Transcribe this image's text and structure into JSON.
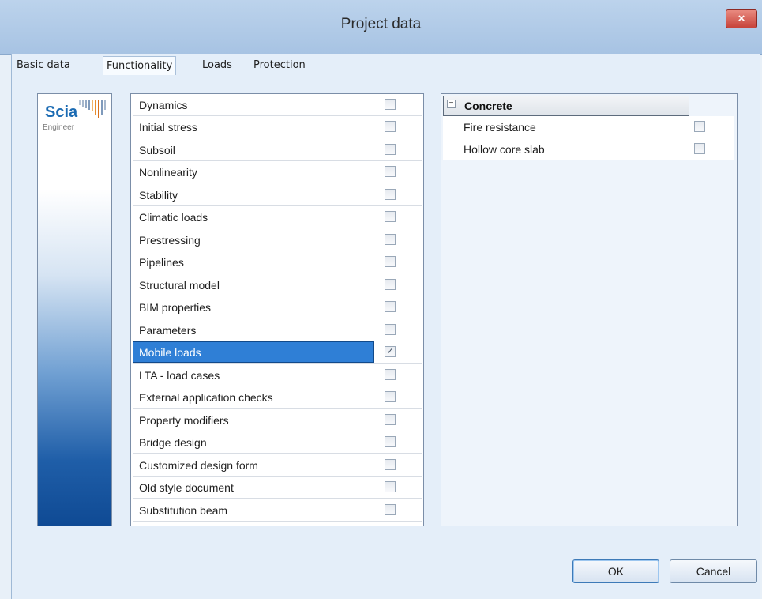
{
  "window": {
    "title": "Project data",
    "close_label": "×"
  },
  "tabs": [
    {
      "label": "Basic data",
      "active": false
    },
    {
      "label": "Functionality",
      "active": true
    },
    {
      "label": "Loads",
      "active": false
    },
    {
      "label": "Protection",
      "active": false
    }
  ],
  "logo": {
    "brand": "Scia",
    "sub": "Engineer"
  },
  "functionality": [
    {
      "label": "Dynamics",
      "checked": false
    },
    {
      "label": "Initial stress",
      "checked": false
    },
    {
      "label": "Subsoil",
      "checked": false
    },
    {
      "label": "Nonlinearity",
      "checked": false
    },
    {
      "label": "Stability",
      "checked": false
    },
    {
      "label": "Climatic loads",
      "checked": false
    },
    {
      "label": "Prestressing",
      "checked": false
    },
    {
      "label": "Pipelines",
      "checked": false
    },
    {
      "label": "Structural model",
      "checked": false
    },
    {
      "label": "BIM properties",
      "checked": false
    },
    {
      "label": "Parameters",
      "checked": false
    },
    {
      "label": "Mobile loads",
      "checked": true,
      "selected": true
    },
    {
      "label": "LTA - load cases",
      "checked": false
    },
    {
      "label": "External application checks",
      "checked": false
    },
    {
      "label": "Property modifiers",
      "checked": false
    },
    {
      "label": "Bridge design",
      "checked": false
    },
    {
      "label": "Customized design form",
      "checked": false
    },
    {
      "label": "Old style document",
      "checked": false
    },
    {
      "label": "Substitution beam",
      "checked": false
    }
  ],
  "properties": {
    "group_title": "Concrete",
    "collapse_symbol": "−",
    "items": [
      {
        "label": "Fire resistance",
        "checked": false
      },
      {
        "label": "Hollow core slab",
        "checked": false
      }
    ]
  },
  "buttons": {
    "ok": "OK",
    "cancel": "Cancel"
  },
  "colors": {
    "selection": "#2f7fd6",
    "brand": "#1b6bb3"
  }
}
